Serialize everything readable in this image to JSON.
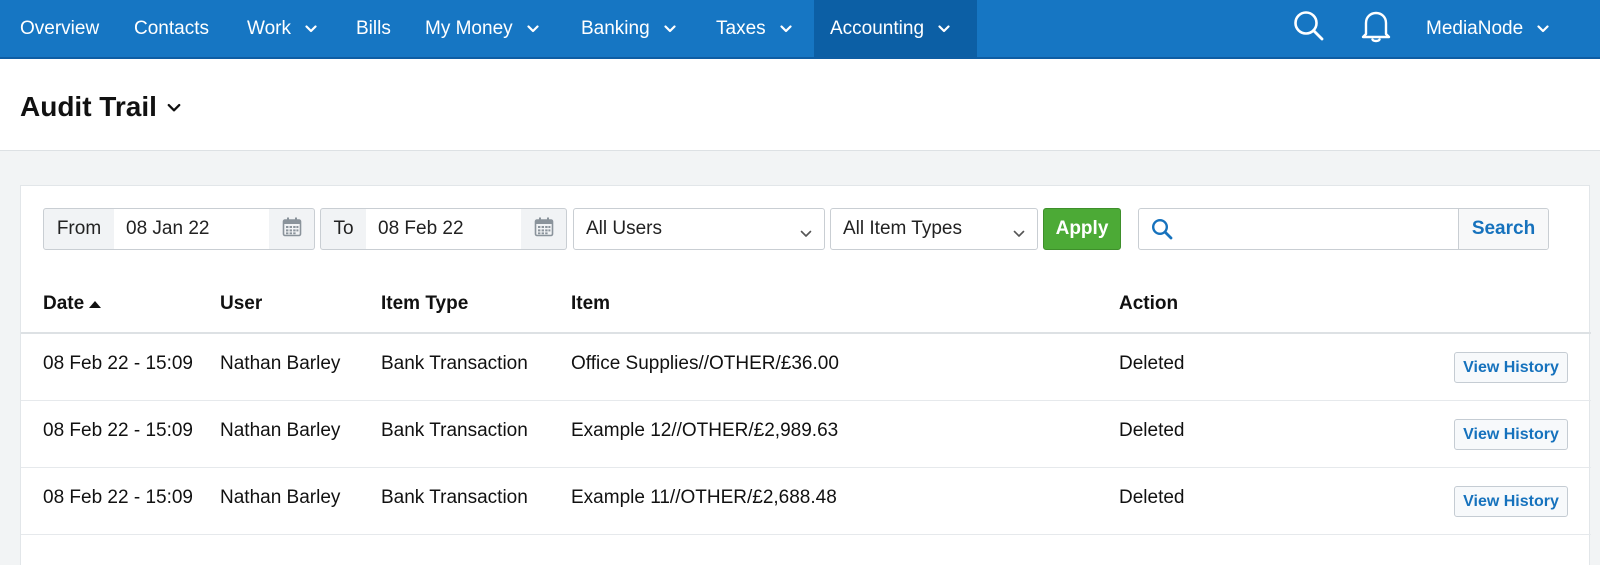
{
  "nav": {
    "items": [
      {
        "label": "Overview",
        "dropdown": false
      },
      {
        "label": "Contacts",
        "dropdown": false
      },
      {
        "label": "Work",
        "dropdown": true
      },
      {
        "label": "Bills",
        "dropdown": false
      },
      {
        "label": "My Money",
        "dropdown": true
      },
      {
        "label": "Banking",
        "dropdown": true
      },
      {
        "label": "Taxes",
        "dropdown": true
      },
      {
        "label": "Accounting",
        "dropdown": true,
        "active": true
      }
    ],
    "account": "MediaNode"
  },
  "page": {
    "title": "Audit Trail"
  },
  "filters": {
    "from_label": "From",
    "from_value": "08 Jan 22",
    "to_label": "To",
    "to_value": "08 Feb 22",
    "users_select": "All Users",
    "item_types_select": "All Item Types",
    "apply_label": "Apply",
    "search_value": "",
    "search_label": "Search"
  },
  "table": {
    "headers": {
      "date": "Date",
      "user": "User",
      "item_type": "Item Type",
      "item": "Item",
      "action": "Action"
    },
    "sort": {
      "column": "date",
      "direction": "ascending"
    },
    "rows": [
      {
        "date": "08 Feb 22 - 15:09",
        "user": "Nathan Barley",
        "item_type": "Bank Transaction",
        "item": "Office Supplies//OTHER/£36.00",
        "action": "Deleted",
        "button": "View History"
      },
      {
        "date": "08 Feb 22 - 15:09",
        "user": "Nathan Barley",
        "item_type": "Bank Transaction",
        "item": "Example 12//OTHER/£2,989.63",
        "action": "Deleted",
        "button": "View History"
      },
      {
        "date": "08 Feb 22 - 15:09",
        "user": "Nathan Barley",
        "item_type": "Bank Transaction",
        "item": "Example 11//OTHER/£2,688.48",
        "action": "Deleted",
        "button": "View History"
      }
    ]
  },
  "colors": {
    "nav_bg": "#1676c3",
    "nav_active_bg": "#0c5fa5",
    "apply_green": "#4caa36",
    "link_blue": "#1672bd"
  }
}
